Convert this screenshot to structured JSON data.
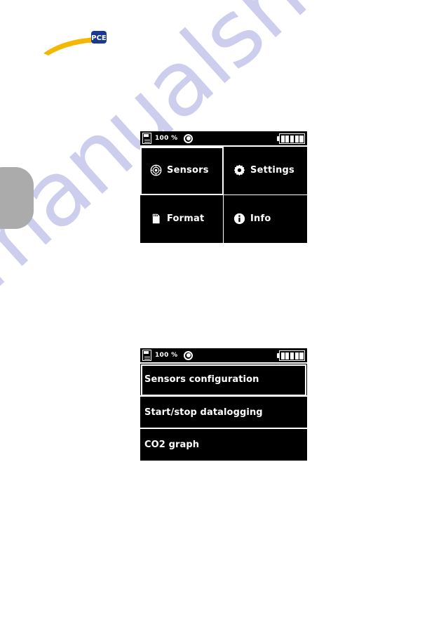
{
  "page": {
    "background_color": "#ffffff",
    "watermark_text": "manualshive.com",
    "watermark_color": "#cdcdee",
    "edge_tab_color": "#ababab"
  },
  "logo": {
    "brand": "PCE",
    "swoosh_color": "#f5b800",
    "badge_color": "#1b3a8f"
  },
  "screen_menu": {
    "status_bar": {
      "sd_icon": "sd-card-icon",
      "percent": "100 %",
      "record_icon": "record-circle-icon",
      "battery_icon": "battery-full-icon",
      "battery_cells": 5
    },
    "tiles": [
      {
        "label": "Sensors",
        "icon": "sensor-icon",
        "selected": true
      },
      {
        "label": "Settings",
        "icon": "gear-icon",
        "selected": false
      },
      {
        "label": "Format",
        "icon": "sd-card-icon",
        "selected": false
      },
      {
        "label": "Info",
        "icon": "info-icon",
        "selected": false
      }
    ]
  },
  "screen_list": {
    "status_bar": {
      "sd_icon": "sd-card-icon",
      "percent": "100 %",
      "record_icon": "record-circle-icon",
      "battery_icon": "battery-full-icon",
      "battery_cells": 5
    },
    "rows": [
      {
        "label": "Sensors configuration",
        "selected": true
      },
      {
        "label": "Start/stop datalogging",
        "selected": false
      },
      {
        "label": "CO2 graph",
        "selected": false
      }
    ]
  }
}
